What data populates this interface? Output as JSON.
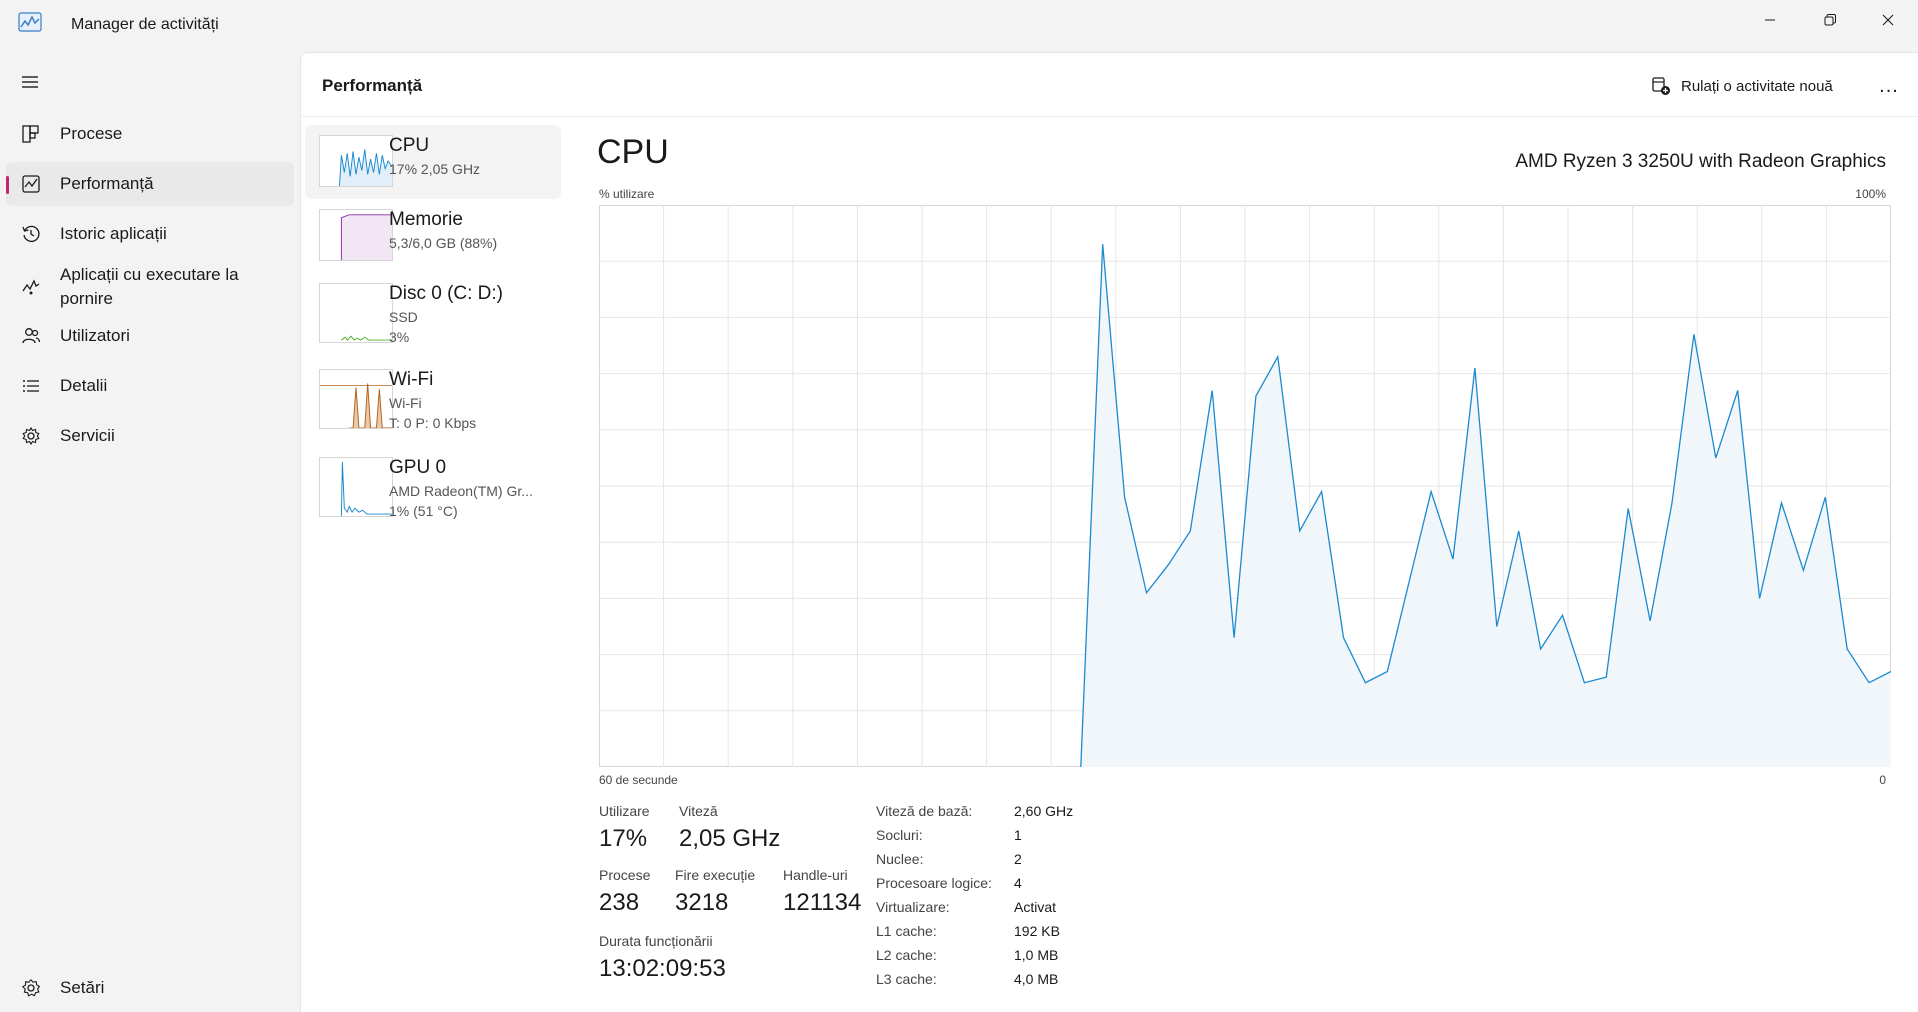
{
  "window": {
    "title": "Manager de activități",
    "icon": "task-manager-icon",
    "controls": [
      "minimize-icon",
      "restore-icon",
      "close-icon"
    ]
  },
  "sidebar": {
    "items": [
      {
        "label": "Procese",
        "icon": "processes-icon"
      },
      {
        "label": "Performanță",
        "icon": "performance-icon",
        "active": true
      },
      {
        "label": "Istoric aplicații",
        "icon": "history-icon"
      },
      {
        "label": "Aplicații cu executare la pornire",
        "icon": "startup-icon"
      },
      {
        "label": "Utilizatori",
        "icon": "users-icon"
      },
      {
        "label": "Detalii",
        "icon": "details-icon"
      },
      {
        "label": "Servicii",
        "icon": "services-icon"
      }
    ],
    "settings": {
      "label": "Setări",
      "icon": "settings-icon"
    }
  },
  "header": {
    "title": "Performanță",
    "run_task_label": "Rulați o activitate nouă",
    "more": "..."
  },
  "resources": [
    {
      "name": "CPU",
      "lines": [
        "17%  2,05 GHz"
      ],
      "color": "#1b8ad0",
      "active": true
    },
    {
      "name": "Memorie",
      "lines": [
        "5,3/6,0 GB (88%)"
      ],
      "color": "#8b2fa8"
    },
    {
      "name": "Disc 0 (C: D:)",
      "lines": [
        "SSD",
        "3%"
      ],
      "color": "#4caf28"
    },
    {
      "name": "Wi-Fi",
      "lines": [
        "Wi-Fi",
        "T: 0 P: 0 Kbps"
      ],
      "color": "#b5621a"
    },
    {
      "name": "GPU 0",
      "lines": [
        "AMD Radeon(TM) Gr...",
        "1% (51 °C)"
      ],
      "color": "#1b8ad0"
    }
  ],
  "detail": {
    "title": "CPU",
    "model": "AMD Ryzen 3 3250U with Radeon Graphics",
    "y_label": "% utilizare",
    "y_max_label": "100%",
    "x_left_label": "60 de secunde",
    "x_right_label": "0",
    "line_color": "#1b8ad0",
    "fill_color": "#f1f6fa",
    "stats": {
      "utilizare": {
        "label": "Utilizare",
        "value": "17%"
      },
      "viteza": {
        "label": "Viteză",
        "value": "2,05 GHz"
      },
      "procese": {
        "label": "Procese",
        "value": "238"
      },
      "fire": {
        "label": "Fire execuție",
        "value": "3218"
      },
      "handle": {
        "label": "Handle-uri",
        "value": "121134"
      },
      "durata": {
        "label": "Durata funcționării",
        "value": "13:02:09:53"
      }
    },
    "specs": [
      {
        "label": "Viteză de bază:",
        "value": "2,60 GHz"
      },
      {
        "label": "Socluri:",
        "value": "1"
      },
      {
        "label": "Nuclee:",
        "value": "2"
      },
      {
        "label": "Procesoare logice:",
        "value": "4"
      },
      {
        "label": "Virtualizare:",
        "value": "Activat"
      },
      {
        "label": "L1 cache:",
        "value": "192 KB"
      },
      {
        "label": "L2 cache:",
        "value": "1,0 MB"
      },
      {
        "label": "L3 cache:",
        "value": "4,0 MB"
      }
    ]
  },
  "chart_data": {
    "type": "area",
    "ylim": [
      0,
      100
    ],
    "xlim": [
      60,
      0
    ],
    "x": [
      60,
      0
    ],
    "series": [
      {
        "values": [
          null,
          null,
          null,
          null,
          null,
          null,
          null,
          null,
          null,
          null,
          null,
          null,
          null,
          null,
          null,
          null,
          null,
          null,
          null,
          null,
          null,
          null,
          0,
          93,
          48,
          31,
          36,
          42,
          67,
          23,
          66,
          73,
          42,
          49,
          23,
          15,
          17,
          33,
          49,
          37,
          71,
          25,
          42,
          21,
          27,
          15,
          16,
          46,
          26,
          47,
          77,
          55,
          67,
          30,
          47,
          35,
          48,
          21,
          15,
          17
        ]
      }
    ]
  }
}
